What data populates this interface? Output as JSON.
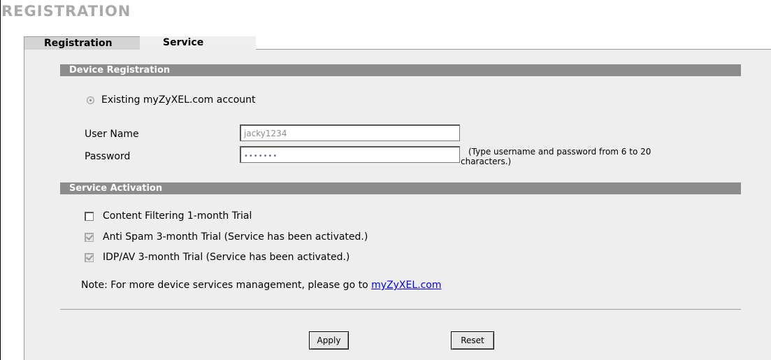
{
  "page": {
    "title": "REGISTRATION"
  },
  "tabs": [
    {
      "label": "Registration",
      "active": true
    },
    {
      "label": "Service",
      "active": false
    }
  ],
  "device_registration": {
    "section_title": "Device Registration",
    "radio_label": "Existing myZyXEL.com account",
    "username_label": "User Name",
    "username_value": "jacky1234",
    "password_label": "Password",
    "password_value": "•••••••",
    "hint_line1": "(Type username and password from 6 to 20",
    "hint_line2": "characters.)"
  },
  "service_activation": {
    "section_title": "Service Activation",
    "items": [
      {
        "label": "Content Filtering 1-month Trial",
        "checked": false
      },
      {
        "label": "Anti Spam 3-month Trial (Service has been activated.)",
        "checked": true
      },
      {
        "label": "IDP/AV 3-month Trial (Service has been activated.)",
        "checked": true
      }
    ]
  },
  "note": {
    "text": "Note: For more device services management, please go to ",
    "link_text": "myZyXEL.com"
  },
  "buttons": {
    "apply": "Apply",
    "reset": "Reset"
  },
  "colors": {
    "section_bar": "#8c8c8c",
    "panel": "#eeeeee",
    "title": "#a9a9a9",
    "link": "#0000ff"
  }
}
